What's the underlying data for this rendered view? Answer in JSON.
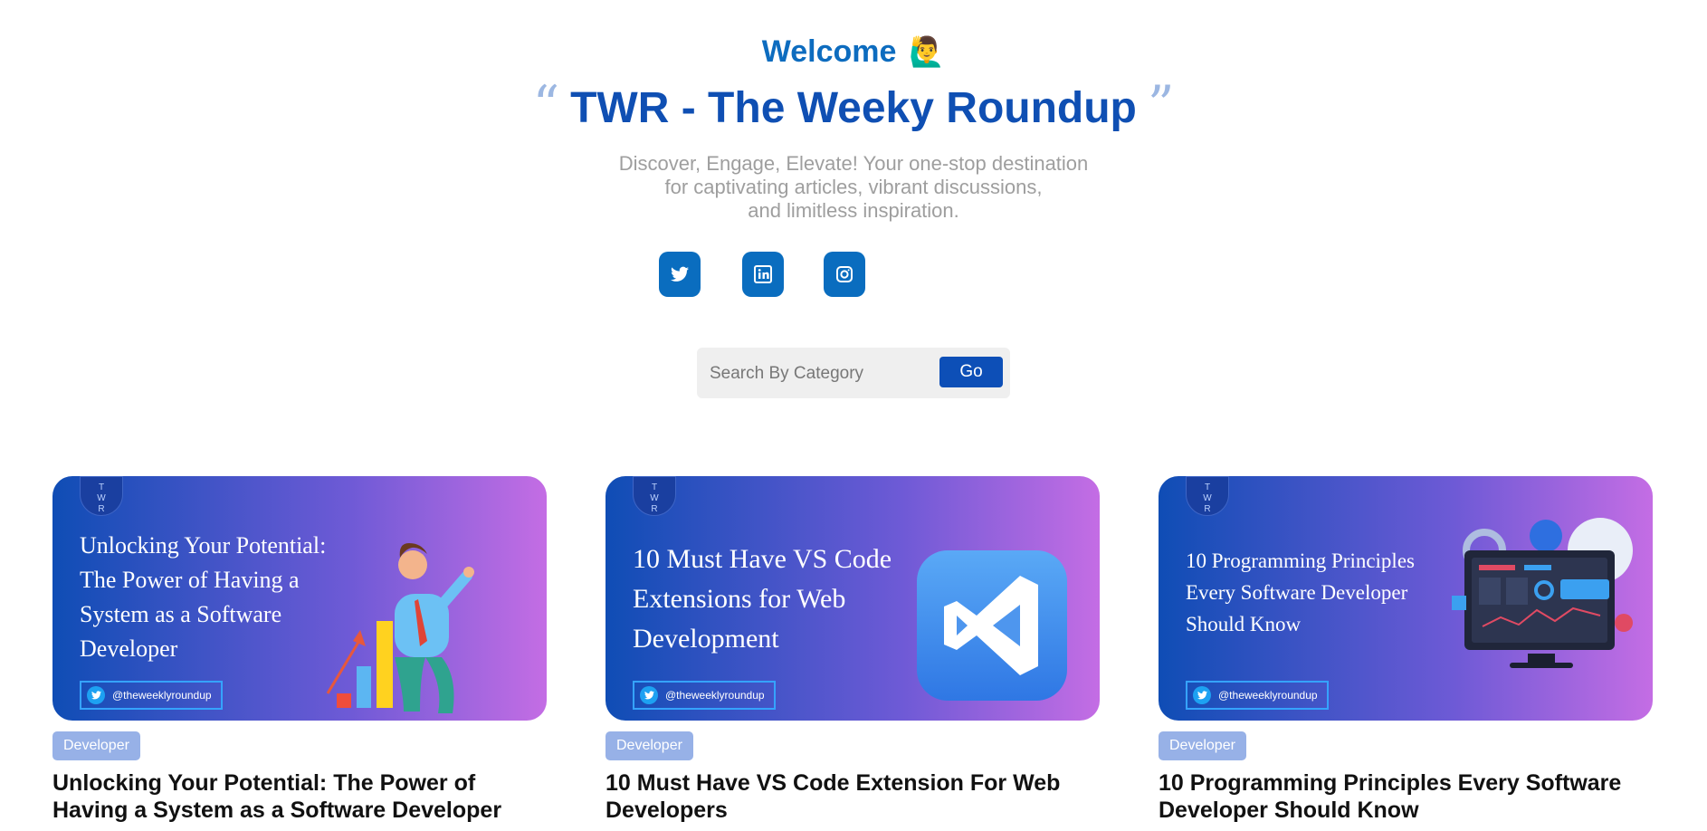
{
  "header": {
    "welcome": "Welcome",
    "welcome_emoji": "🙋‍♂️",
    "open_quote": "“",
    "title": "TWR - The Weeky Roundup",
    "close_quote": "”",
    "tagline_lines": [
      "Discover, Engage, Elevate! Your one-stop destination",
      "for captivating articles, vibrant discussions,",
      "and limitless inspiration."
    ]
  },
  "socials": [
    {
      "name": "twitter",
      "icon": "twitter-icon"
    },
    {
      "name": "linkedin",
      "icon": "linkedin-icon"
    },
    {
      "name": "instagram",
      "icon": "instagram-icon"
    }
  ],
  "search": {
    "placeholder": "Search By Category",
    "button": "Go"
  },
  "cards": [
    {
      "thumb_lines": [
        "Unlocking Your Potential:",
        "The Power of Having a",
        "System as a Software",
        "Developer"
      ],
      "handle": "@theweeklyroundup",
      "badge": "Developer",
      "title": "Unlocking Your Potential: The Power of Having a System as a Software Developer"
    },
    {
      "thumb_lines": [
        "10 Must Have VS Code",
        "Extensions for Web",
        "Development"
      ],
      "handle": "@theweeklyroundup",
      "badge": "Developer",
      "title": "10 Must Have VS Code Extension For Web Developers"
    },
    {
      "thumb_lines": [
        "10 Programming Principles",
        "Every Software Developer",
        "Should Know"
      ],
      "handle": "@theweeklyroundup",
      "badge": "Developer",
      "title": "10 Programming Principles Every Software Developer Should Know"
    }
  ],
  "logo_text": [
    "T",
    "W",
    "R"
  ],
  "colors": {
    "accent": "#0f4fb3",
    "welcome": "#0d6cbf",
    "social": "#0a6dbf",
    "badge": "#97b1e7"
  }
}
